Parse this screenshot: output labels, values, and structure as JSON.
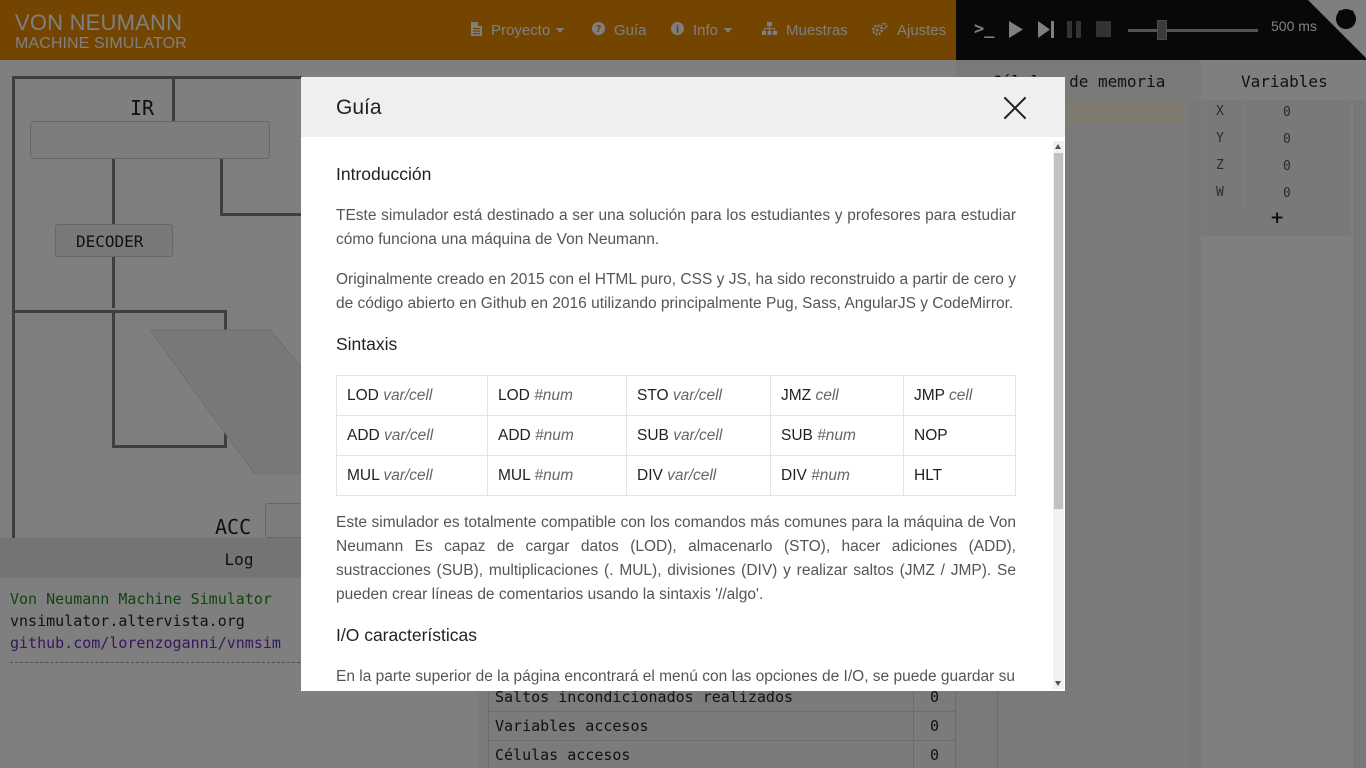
{
  "header": {
    "brand_line1": "VON NEUMANN",
    "brand_line2": "MACHINE SIMULATOR",
    "nav": [
      {
        "label": "Proyecto",
        "icon": "file-icon"
      },
      {
        "label": "Guía",
        "icon": "question-circle-icon"
      },
      {
        "label": "Info",
        "icon": "info-circle-icon"
      },
      {
        "label": "Muestras",
        "icon": "sitemap-icon"
      },
      {
        "label": "Ajustes",
        "icon": "cogs-icon"
      }
    ],
    "controls": {
      "terminal_glyph": ">_",
      "speed": "500 ms",
      "speed_slider_fraction": 0.26
    }
  },
  "machine": {
    "ir_label": "IR",
    "decoder_label": "DECODER",
    "acc_label": "ACC"
  },
  "log": {
    "title": "Log",
    "lines": [
      "Von Neumann Machine Simulator",
      "vnsimulator.altervista.org",
      "github.com/lorenzoganni/vnmsim"
    ]
  },
  "stats": [
    {
      "label": "Saltos incondicionados realizados",
      "value": "0"
    },
    {
      "label": "Variables accesos",
      "value": "0"
    },
    {
      "label": "Células accesos",
      "value": "0"
    }
  ],
  "memory": {
    "title": "Células de memoria"
  },
  "variables": {
    "title": "Variables",
    "rows": [
      {
        "name": "X",
        "value": "0"
      },
      {
        "name": "Y",
        "value": "0"
      },
      {
        "name": "Z",
        "value": "0"
      },
      {
        "name": "W",
        "value": "0"
      }
    ],
    "add_glyph": "+"
  },
  "modal": {
    "title": "Guía",
    "intro_heading": "Introducción",
    "intro_p1": "TEste simulador está destinado a ser una solución para los estudiantes y profesores para estudiar cómo funciona una máquina de Von Neumann.",
    "intro_p2": "Originalmente creado en 2015 con el HTML puro, CSS y JS, ha sido reconstruido a partir de cero y de código abierto en Github en 2016 utilizando principalmente Pug, Sass, AngularJS y CodeMirror.",
    "syntax_heading": "Sintaxis",
    "syntax_rows": [
      [
        {
          "op": "LOD",
          "arg": "var/cell"
        },
        {
          "op": "LOD",
          "arg": "#num"
        },
        {
          "op": "STO",
          "arg": "var/cell"
        },
        {
          "op": "JMZ",
          "arg": "cell"
        },
        {
          "op": "JMP",
          "arg": "cell"
        }
      ],
      [
        {
          "op": "ADD",
          "arg": "var/cell"
        },
        {
          "op": "ADD",
          "arg": "#num"
        },
        {
          "op": "SUB",
          "arg": "var/cell"
        },
        {
          "op": "SUB",
          "arg": "#num"
        },
        {
          "op": "NOP",
          "arg": ""
        }
      ],
      [
        {
          "op": "MUL",
          "arg": "var/cell"
        },
        {
          "op": "MUL",
          "arg": "#num"
        },
        {
          "op": "DIV",
          "arg": "var/cell"
        },
        {
          "op": "DIV",
          "arg": "#num"
        },
        {
          "op": "HLT",
          "arg": ""
        }
      ]
    ],
    "syntax_p": "Este simulador es totalmente compatible con los comandos más comunes para la máquina de Von Neumann Es capaz de cargar datos (LOD), almacenarlo (STO), hacer adiciones (ADD), sustracciones (SUB), multiplicaciones (. MUL), divisiones (DIV) y realizar saltos (JMZ / JMP). Se pueden crear líneas de comentarios usando la sintaxis '//algo'.",
    "io_heading": "I/O características",
    "io_p": "En la parte superior de la página encontrará el menú con las opciones de I/O, se puede guardar su"
  }
}
